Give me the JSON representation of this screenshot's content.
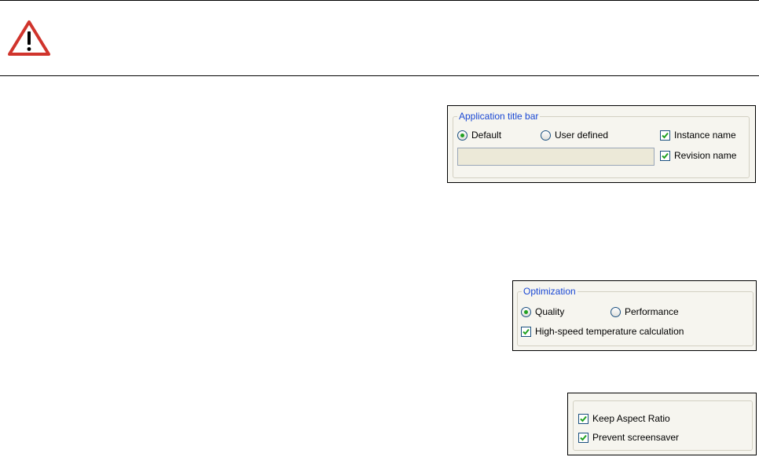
{
  "colors": {
    "legend": "#1a48d4",
    "warning": "#d0342c",
    "check": "#21a121"
  },
  "warning": {
    "icon": "warning-triangle-icon"
  },
  "title_bar": {
    "legend": "Application title bar",
    "default_label": "Default",
    "default_selected": true,
    "user_defined_label": "User defined",
    "user_defined_selected": false,
    "instance_name_label": "Instance name",
    "instance_name_checked": true,
    "revision_name_label": "Revision name",
    "revision_name_checked": true,
    "custom_title_value": ""
  },
  "optimization": {
    "legend": "Optimization",
    "quality_label": "Quality",
    "quality_selected": true,
    "performance_label": "Performance",
    "performance_selected": false,
    "high_speed_label": "High-speed temperature calculation",
    "high_speed_checked": true
  },
  "display": {
    "keep_aspect_label": "Keep Aspect Ratio",
    "keep_aspect_checked": true,
    "prevent_screensaver_label": "Prevent screensaver",
    "prevent_screensaver_checked": true
  }
}
